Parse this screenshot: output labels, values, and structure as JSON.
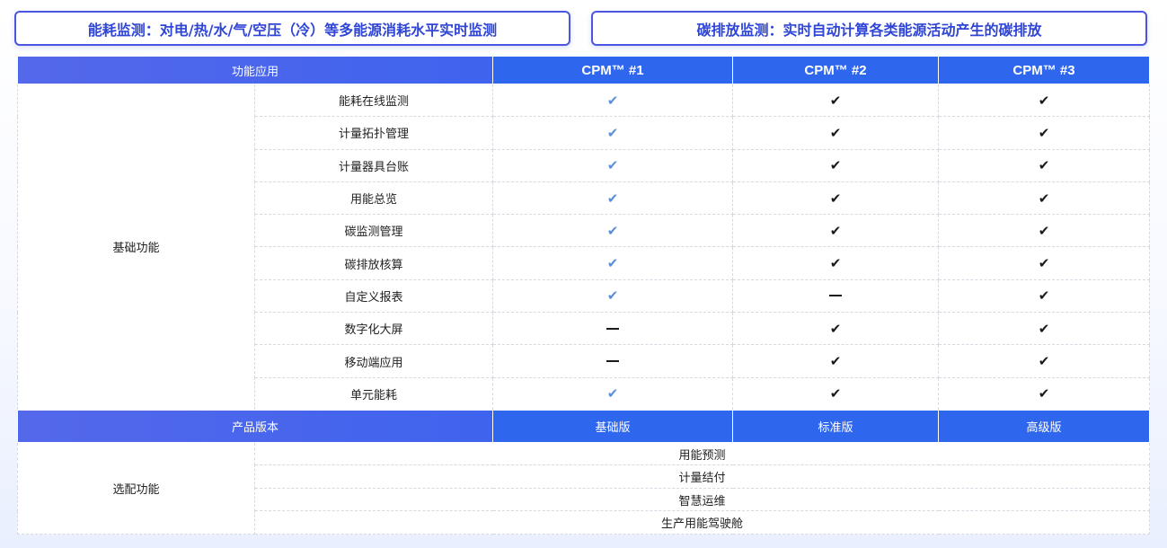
{
  "banners": {
    "left": "能耗监测：对电/热/水/气/空压（冷）等多能源消耗水平实时监测",
    "right": "碳排放监测：实时自动计算各类能源活动产生的碳排放"
  },
  "table": {
    "header": {
      "feature_col": "功能应用",
      "plans": [
        "CPM™ #1",
        "CPM™ #2",
        "CPM™ #3"
      ]
    },
    "base_category": "基础功能",
    "features": [
      {
        "name": "能耗在线监测",
        "values": [
          "check-light",
          "check",
          "check"
        ]
      },
      {
        "name": "计量拓扑管理",
        "values": [
          "check-light",
          "check",
          "check"
        ]
      },
      {
        "name": "计量器具台账",
        "values": [
          "check-light",
          "check",
          "check"
        ]
      },
      {
        "name": "用能总览",
        "values": [
          "check-light",
          "check",
          "check"
        ]
      },
      {
        "name": "碳监测管理",
        "values": [
          "check-light",
          "check",
          "check"
        ]
      },
      {
        "name": "碳排放核算",
        "values": [
          "check-light",
          "check",
          "check"
        ]
      },
      {
        "name": "自定义报表",
        "values": [
          "check-light",
          "dash",
          "check"
        ]
      },
      {
        "name": "数字化大屏",
        "values": [
          "dash",
          "check",
          "check"
        ]
      },
      {
        "name": "移动端应用",
        "values": [
          "dash",
          "check",
          "check"
        ]
      },
      {
        "name": "单元能耗",
        "values": [
          "check-light",
          "check",
          "check"
        ]
      }
    ],
    "version_row": {
      "label": "产品版本",
      "versions": [
        "基础版",
        "标准版",
        "高级版"
      ]
    },
    "optional_category": "选配功能",
    "optional_features": [
      "用能预测",
      "计量结付",
      "智慧运维",
      "生产用能驾驶舱"
    ]
  },
  "glyphs": {
    "check": "✔",
    "dash": "—"
  },
  "colors": {
    "accent_blue": "#2f66ee",
    "banner_text": "#2f45d6",
    "check_light": "#5a8fd8",
    "check_dark": "#1a1a1a"
  }
}
